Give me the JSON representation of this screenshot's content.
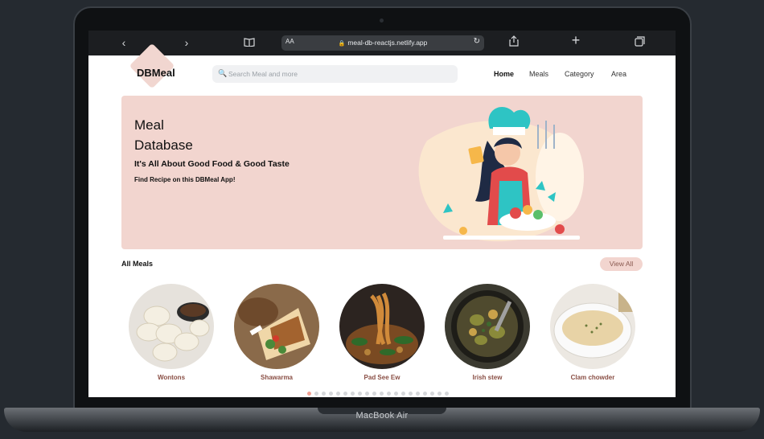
{
  "device": {
    "label": "MacBook Air"
  },
  "browser": {
    "text_size_label": "AA",
    "url": "meal-db-reactjs.netlify.app",
    "icons": [
      "back-icon",
      "forward-icon",
      "bookmarks-icon",
      "lock-icon",
      "reload-icon",
      "share-icon",
      "new-tab-icon",
      "tabs-icon"
    ]
  },
  "header": {
    "logo": "DBMeal",
    "search_placeholder": "Search Meal and more",
    "nav": [
      {
        "label": "Home",
        "active": true
      },
      {
        "label": "Meals",
        "active": false
      },
      {
        "label": "Category",
        "active": false
      },
      {
        "label": "Area",
        "active": false
      }
    ]
  },
  "hero": {
    "title_line1": "Meal",
    "title_line2": "Database",
    "subtitle": "It's All About Good Food & Good Taste",
    "tagline": "Find Recipe on this DBMeal App!"
  },
  "meals_section": {
    "title": "All Meals",
    "view_all": "View All",
    "meals": [
      {
        "name": "Wontons"
      },
      {
        "name": "Shawarma"
      },
      {
        "name": "Pad See Ew"
      },
      {
        "name": "Irish stew"
      },
      {
        "name": "Clam chowder"
      }
    ],
    "pagination_dots": 20,
    "active_dot": 1
  },
  "colors": {
    "accent": "#f2d5cf",
    "meal_name": "#8a4f45",
    "active_dot": "#f2a093"
  }
}
